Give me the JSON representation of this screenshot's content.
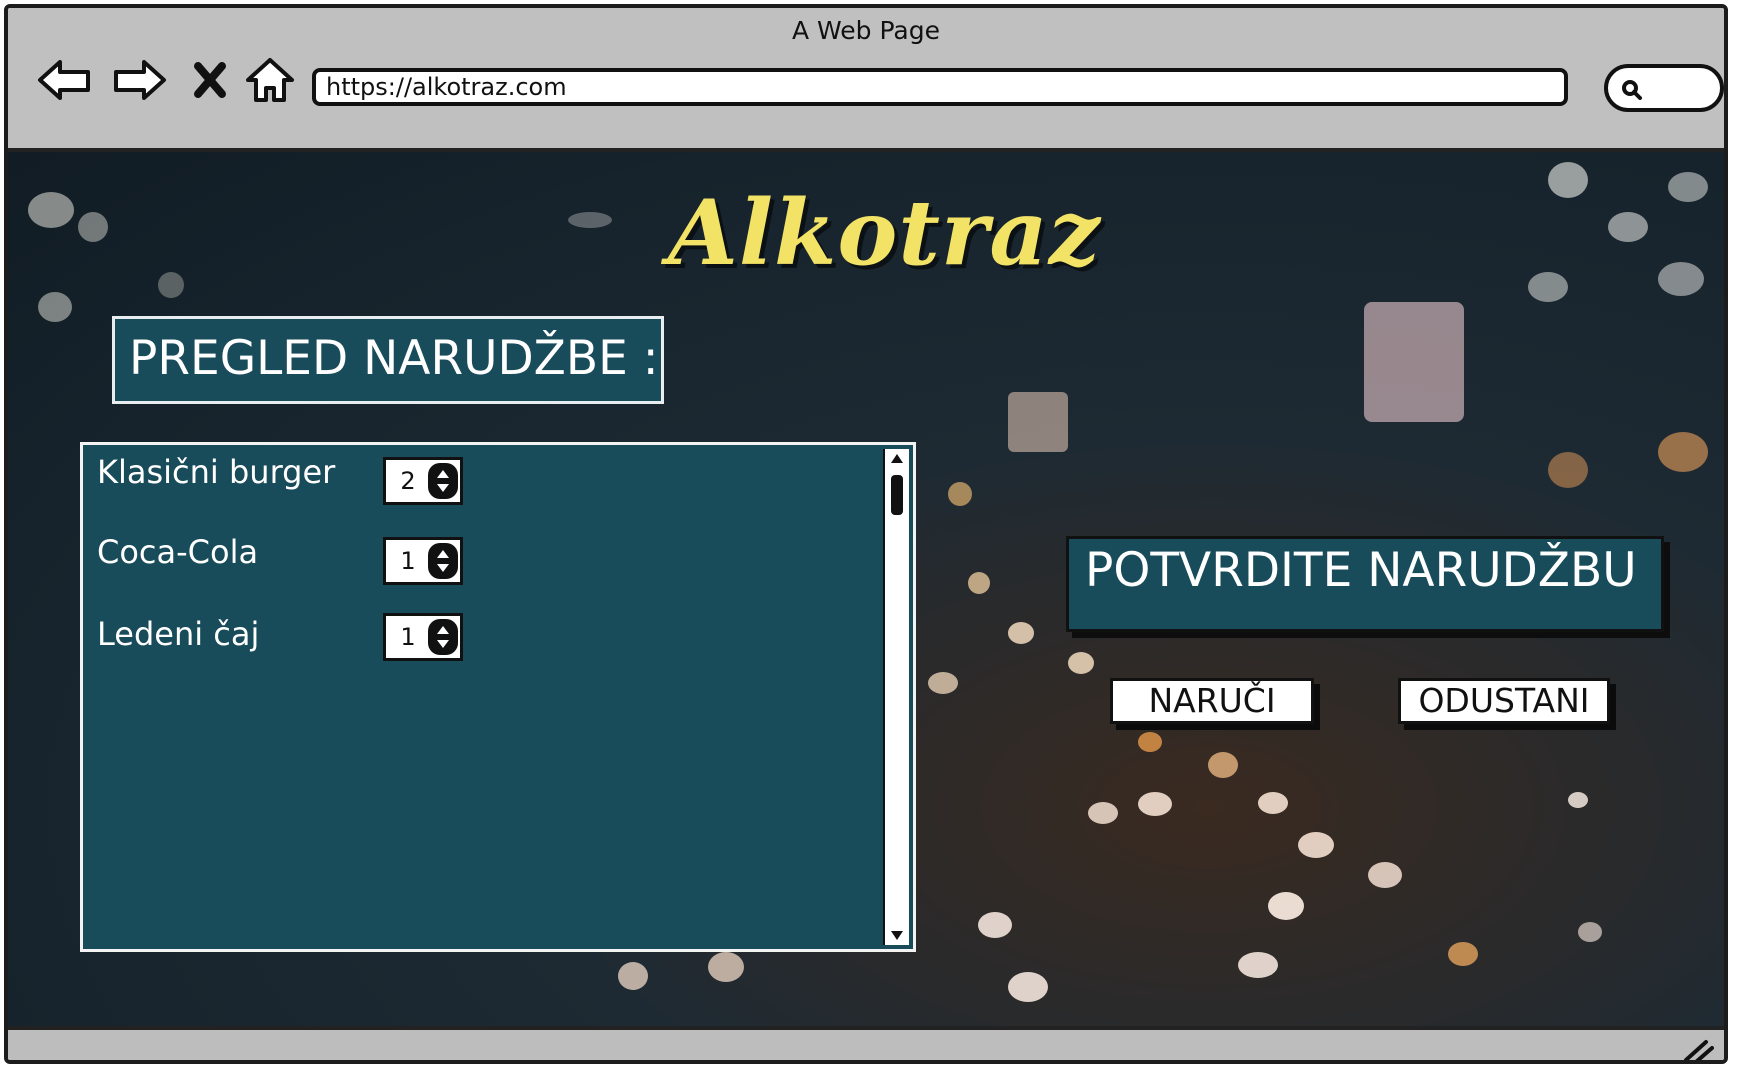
{
  "window": {
    "title": "A Web Page"
  },
  "browser": {
    "url": "https://alkotraz.com",
    "nav": {
      "back_icon": "back-arrow-icon",
      "forward_icon": "forward-arrow-icon",
      "close_icon": "close-icon",
      "home_icon": "home-icon"
    },
    "search_icon": "search-icon"
  },
  "page": {
    "logo": "Alkotraz",
    "order_review_title": "PREGLED NARUDŽBE :",
    "order_items": [
      {
        "name": "Klasični burger",
        "quantity": "2"
      },
      {
        "name": "Coca-Cola",
        "quantity": "1"
      },
      {
        "name": "Ledeni čaj",
        "quantity": "1"
      }
    ],
    "confirm_title": "POTVRDITE NARUDŽBU",
    "order_button": "NARUČI",
    "cancel_button": "ODUSTANI"
  },
  "colors": {
    "panel": "#194c5a",
    "logo": "#f2e266",
    "frame": "#bdbdbd"
  }
}
